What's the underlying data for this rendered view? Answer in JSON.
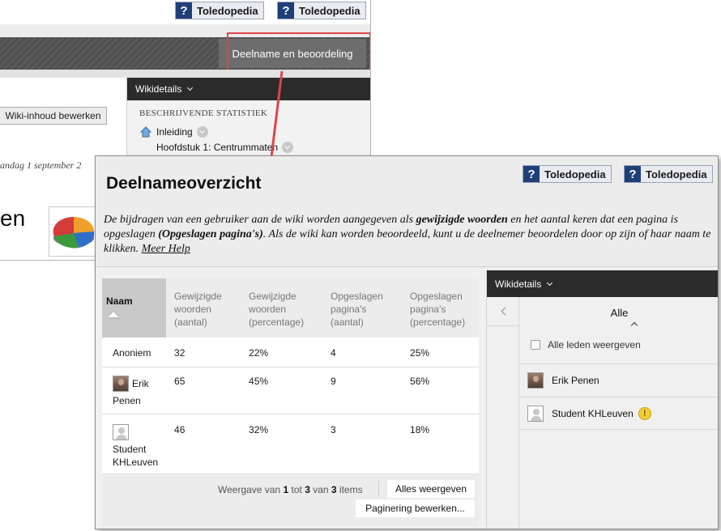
{
  "background_window": {
    "help_buttons": [
      {
        "icon": "?",
        "label": "Toledopedia"
      },
      {
        "icon": "?",
        "label": "Toledopedia"
      }
    ],
    "active_tab": "Deelname en beoordeling",
    "edit_button": "Wiki-inhoud bewerken",
    "date_fragment": "andag 1 september 2",
    "large_text_fragment": "en",
    "sidebar": {
      "header": "Wikidetails",
      "section_title": "BESCHRIJVENDE STATISTIEK",
      "links": [
        "Inleiding",
        "Hoofdstuk 1: Centrummaten"
      ]
    }
  },
  "front_window": {
    "help_buttons": [
      {
        "icon": "?",
        "label": "Toledopedia"
      },
      {
        "icon": "?",
        "label": "Toledopedia"
      }
    ],
    "title": "Deelnameoverzicht",
    "description": {
      "part1": "De bijdragen van een gebruiker aan de wiki worden aangegeven als ",
      "bold1": "gewijzigde woorden",
      "part2": " en het aantal keren dat een pagina is opgeslagen ",
      "bold2": "(Opgeslagen pagina's)",
      "part3": ". Als de wiki kan worden beoordeeld, kunt u de deelnemer beoordelen door op zijn of haar naam te klikken. ",
      "link": "Meer Help"
    },
    "table": {
      "headers": {
        "name": "Naam",
        "words_count": "Gewijzigde woorden (aantal)",
        "words_pct": "Gewijzigde woorden (percentage)",
        "pages_count": "Opgeslagen pagina's (aantal)",
        "pages_pct": "Opgeslagen pagina's (percentage)"
      },
      "rows": [
        {
          "name": "Anoniem",
          "words_count": "32",
          "words_pct": "22%",
          "pages_count": "4",
          "pages_pct": "25%"
        },
        {
          "name": "Erik Penen",
          "words_count": "65",
          "words_pct": "45%",
          "pages_count": "9",
          "pages_pct": "56%"
        },
        {
          "name": "Student KHLeuven",
          "words_count": "46",
          "words_pct": "32%",
          "pages_count": "3",
          "pages_pct": "18%"
        }
      ]
    },
    "pager": {
      "prefix": "Weergave van ",
      "from": "1",
      "middle": " tot ",
      "to": "3",
      "of_text": " van ",
      "total": "3",
      "suffix": " items",
      "show_all": "Alles weergeven",
      "edit_paging": "Paginering bewerken..."
    },
    "sidebar": {
      "header": "Wikidetails",
      "members_title": "Alle",
      "show_all_members": "Alle leden weergeven",
      "members": [
        "Erik Penen",
        "Student KHLeuven"
      ],
      "warning_icon": "!"
    }
  },
  "colors": {
    "highlight": "#e0434c",
    "dark_bar": "#2b2b2b",
    "help_icon": "#1f3f7a"
  }
}
